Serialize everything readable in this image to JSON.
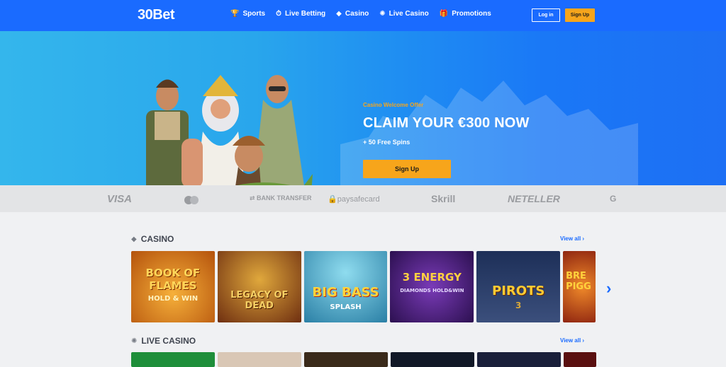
{
  "nav": {
    "logo": "30Bet",
    "links": [
      {
        "label": "Sports",
        "icon": "trophy-icon"
      },
      {
        "label": "Live Betting",
        "icon": "stopwatch-icon"
      },
      {
        "label": "Casino",
        "icon": "diamond-icon"
      },
      {
        "label": "Live Casino",
        "icon": "roulette-icon"
      },
      {
        "label": "Promotions",
        "icon": "gift-icon"
      }
    ],
    "login": "Log in",
    "signup": "Sign Up"
  },
  "hero": {
    "subtitle": "Casino Welcome Offer",
    "title": "CLAIM YOUR €300 NOW",
    "extra": "+ 50 Free Spins",
    "cta": "Sign Up"
  },
  "payments": [
    "VISA",
    "mastercard",
    "BANK TRANSFER",
    "paysafecard",
    "Skrill",
    "NETELLER",
    "G"
  ],
  "casino": {
    "title": "CASINO",
    "view_all": "View all",
    "games": [
      {
        "name": "BOOK OF FLAMES",
        "sub": "HOLD & WIN",
        "bg": "#d97a12"
      },
      {
        "name": "LEGACY OF DEAD",
        "sub": "",
        "bg": "#a3541c"
      },
      {
        "name": "BIG BASS",
        "sub": "SPLASH",
        "bg": "#3fb0c9"
      },
      {
        "name": "3 ENERGY",
        "sub": "DIAMONDS HOLD&WIN",
        "bg": "#5a2b8e"
      },
      {
        "name": "PIROTS",
        "sub": "3",
        "bg": "#27406a"
      },
      {
        "name": "BRE PIGG",
        "sub": "",
        "bg": "#c4431e"
      }
    ]
  },
  "live_casino": {
    "title": "LIVE CASINO",
    "view_all": "View all"
  },
  "colors": {
    "nav": "#1a6bff",
    "accent": "#f7a51b"
  }
}
